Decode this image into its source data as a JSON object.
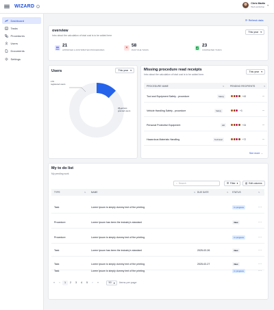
{
  "brand": {
    "name": "WIZARD"
  },
  "user": {
    "name": "Chris Martin",
    "role": "Web workshop"
  },
  "sidebar": {
    "items": [
      {
        "label": "Dashboard",
        "icon": "chart-line-icon",
        "active": true
      },
      {
        "label": "Tasks",
        "icon": "checklist-icon",
        "active": false
      },
      {
        "label": "Procedures",
        "icon": "procedure-icon",
        "active": false
      },
      {
        "label": "Users",
        "icon": "users-icon",
        "active": false
      },
      {
        "label": "Documents",
        "icon": "document-icon",
        "active": false
      },
      {
        "label": "Settings",
        "icon": "gear-icon",
        "active": false
      }
    ]
  },
  "refresh": {
    "label": "Refresh data"
  },
  "overview": {
    "title": "overview",
    "subtitle": "Intro about the calculation of total cost is to be added here.",
    "period": "This year",
    "stats": [
      {
        "value": "21",
        "label": "Approved & distributed procedures",
        "color": "#4f46e5",
        "bg": "#e0e7ff"
      },
      {
        "value": "58",
        "label": "Past due tasks",
        "color": "#dc2626",
        "bg": "#fee2e2"
      },
      {
        "value": "23",
        "label": "Completed tasks",
        "color": "#16a34a",
        "bg": "#dcfce7"
      }
    ]
  },
  "users": {
    "title": "Users",
    "period": "This year",
    "chart_data": {
      "type": "pie",
      "slices": [
        {
          "label": "registered users",
          "value": 176,
          "color": "#f0f1f4"
        },
        {
          "label": "access granted users",
          "value": 25,
          "color": "#2563eb"
        }
      ]
    },
    "callout_left_value": "176",
    "callout_left_label": "registered users",
    "callout_right_value": "25 access",
    "callout_right_label": "granted users"
  },
  "receipts": {
    "title": "Missing procedure read receipts",
    "subtitle": "Intro about the calculation of total cost is to be added here.",
    "period": "This year",
    "col_name": "Procedure name",
    "col_recipients": "Pending recipients",
    "rows": [
      {
        "name": "Tool and Equipment Safety - procedure",
        "tag": "Safety",
        "count": "+43"
      },
      {
        "name": "Vehicle Handling Safety - procedure",
        "tag": "Safety",
        "count": "+3"
      },
      {
        "name": "Personal Protective Equipment",
        "tag": "HR",
        "count": "+24"
      },
      {
        "name": "Hazardous Materials Handling",
        "tag": "Technical",
        "count": "+72"
      }
    ],
    "see_more": "See more"
  },
  "todo": {
    "title": "My to do list",
    "subtitle": "My pending work",
    "search_placeholder": "Search",
    "filter_label": "Filter",
    "edit_columns_label": "Edit columns",
    "columns": {
      "type": "Type",
      "name": "Name",
      "due": "Due date",
      "status": "Status"
    },
    "rows": [
      {
        "type": "Task",
        "name": "Lorem Ipsum is simply dummy text of the printing",
        "due": "",
        "status": "In progress"
      },
      {
        "type": "Procedure",
        "name": "Lorem Ipsum has been the industry's standard",
        "due": "",
        "status": "New"
      },
      {
        "type": "Procedure",
        "name": "Lorem Ipsum is simply dummy text of the printing",
        "due": "",
        "status": "In progress"
      },
      {
        "type": "Task",
        "name": "Lorem Ipsum has been the industry's standard",
        "due": "2025-02-26",
        "status": "New"
      },
      {
        "type": "Task",
        "name": "Lorem Ipsum is simply dummy text of the printing",
        "due": "2025-02-27",
        "status": "New"
      },
      {
        "type": "Task",
        "name": "Lorem Ipsum is simply dummy text of the printing",
        "due": "",
        "status": "In progress"
      }
    ],
    "pagination": {
      "pages": [
        "1",
        "2",
        "3",
        "4",
        "5"
      ],
      "current": "1",
      "per_page": "50",
      "per_page_label": "Items per page"
    }
  }
}
